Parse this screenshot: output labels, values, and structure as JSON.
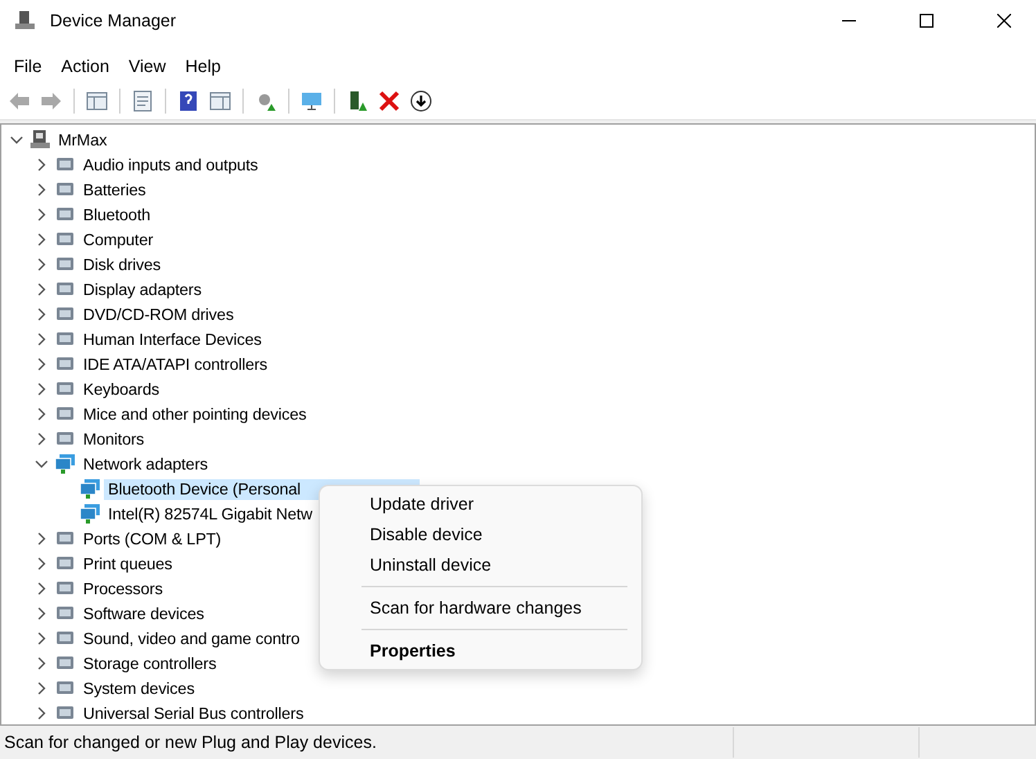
{
  "window": {
    "title": "Device Manager"
  },
  "menu_bar": [
    "File",
    "Action",
    "View",
    "Help"
  ],
  "tree": {
    "label": "MrMax",
    "expanded": true,
    "children": [
      {
        "label": "Audio inputs and outputs",
        "expanded": false
      },
      {
        "label": "Batteries",
        "expanded": false
      },
      {
        "label": "Bluetooth",
        "expanded": false
      },
      {
        "label": "Computer",
        "expanded": false
      },
      {
        "label": "Disk drives",
        "expanded": false
      },
      {
        "label": "Display adapters",
        "expanded": false
      },
      {
        "label": "DVD/CD-ROM drives",
        "expanded": false
      },
      {
        "label": "Human Interface Devices",
        "expanded": false
      },
      {
        "label": "IDE ATA/ATAPI controllers",
        "expanded": false
      },
      {
        "label": "Keyboards",
        "expanded": false
      },
      {
        "label": "Mice and other pointing devices",
        "expanded": false
      },
      {
        "label": "Monitors",
        "expanded": false
      },
      {
        "label": "Network adapters",
        "expanded": true,
        "children": [
          {
            "label": "Bluetooth Device (Personal",
            "selected": true
          },
          {
            "label": "Intel(R) 82574L Gigabit Netw",
            "selected": false
          }
        ]
      },
      {
        "label": "Ports (COM & LPT)",
        "expanded": false
      },
      {
        "label": "Print queues",
        "expanded": false
      },
      {
        "label": "Processors",
        "expanded": false
      },
      {
        "label": "Software devices",
        "expanded": false
      },
      {
        "label": "Sound, video and game contro",
        "expanded": false
      },
      {
        "label": "Storage controllers",
        "expanded": false
      },
      {
        "label": "System devices",
        "expanded": false
      },
      {
        "label": "Universal Serial Bus controllers",
        "expanded": false
      }
    ]
  },
  "context_menu": [
    {
      "kind": "item",
      "label": "Update driver"
    },
    {
      "kind": "item",
      "label": "Disable device"
    },
    {
      "kind": "item",
      "label": "Uninstall device"
    },
    {
      "kind": "separator"
    },
    {
      "kind": "item",
      "label": "Scan for hardware changes"
    },
    {
      "kind": "separator"
    },
    {
      "kind": "default",
      "label": "Properties"
    }
  ],
  "status_bar": "Scan for changed or new Plug and Play devices."
}
